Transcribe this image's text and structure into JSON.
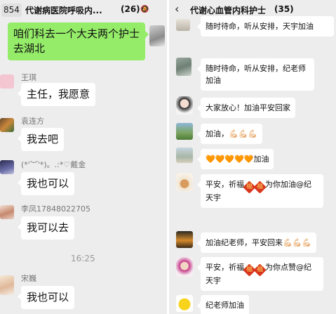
{
  "left_chat": {
    "unread_badge": "854",
    "title": "代谢病医院呼吸内...",
    "member_count": "(26)",
    "mute_icon": "mute-bell-icon",
    "messages": [
      {
        "type": "own",
        "text": "咱们科去一个大夫两个护士去湖北"
      },
      {
        "sender": "王琪",
        "text": "主任，我愿意"
      },
      {
        "sender": "袁连方",
        "text": "我去吧"
      },
      {
        "sender": "(*'︶'*)。.:*♡戴金",
        "text": "我也可以"
      },
      {
        "sender": "李凤17848022705",
        "text": "我可以去"
      },
      {
        "time": "16:25"
      },
      {
        "sender": "宋巍",
        "text": "我也可以"
      }
    ]
  },
  "right_chat": {
    "back_icon": "back-chevron-icon",
    "title": "代谢心血管内科护士",
    "member_count": "(35)",
    "messages": [
      {
        "text": "随时待命，听从安排，天宇加油"
      },
      {
        "text": "随时待命，听从安排，纪老师加油"
      },
      {
        "text": "大家放心！加油平安回家"
      },
      {
        "text": "加油，",
        "emoji": "💪🏻💪🏻💪🏻"
      },
      {
        "emoji": "🧡🧡🧡🧡🧡",
        "text": "加油"
      },
      {
        "pre": "平安，祈福",
        "mid": "为你加油@纪天宇",
        "stamp": "福"
      },
      {
        "text": "加油纪老师，平安回来",
        "emoji": "💪🏻💪🏻💪🏻"
      },
      {
        "pre": "平安，祈福",
        "mid": "为你点赞@纪天宇",
        "stamp": "福"
      },
      {
        "text": "纪老师加油"
      }
    ]
  },
  "colors": {
    "own_bubble": "#95ec69",
    "chat_bg": "#ededed",
    "fu_stamp": "#d8351c"
  }
}
